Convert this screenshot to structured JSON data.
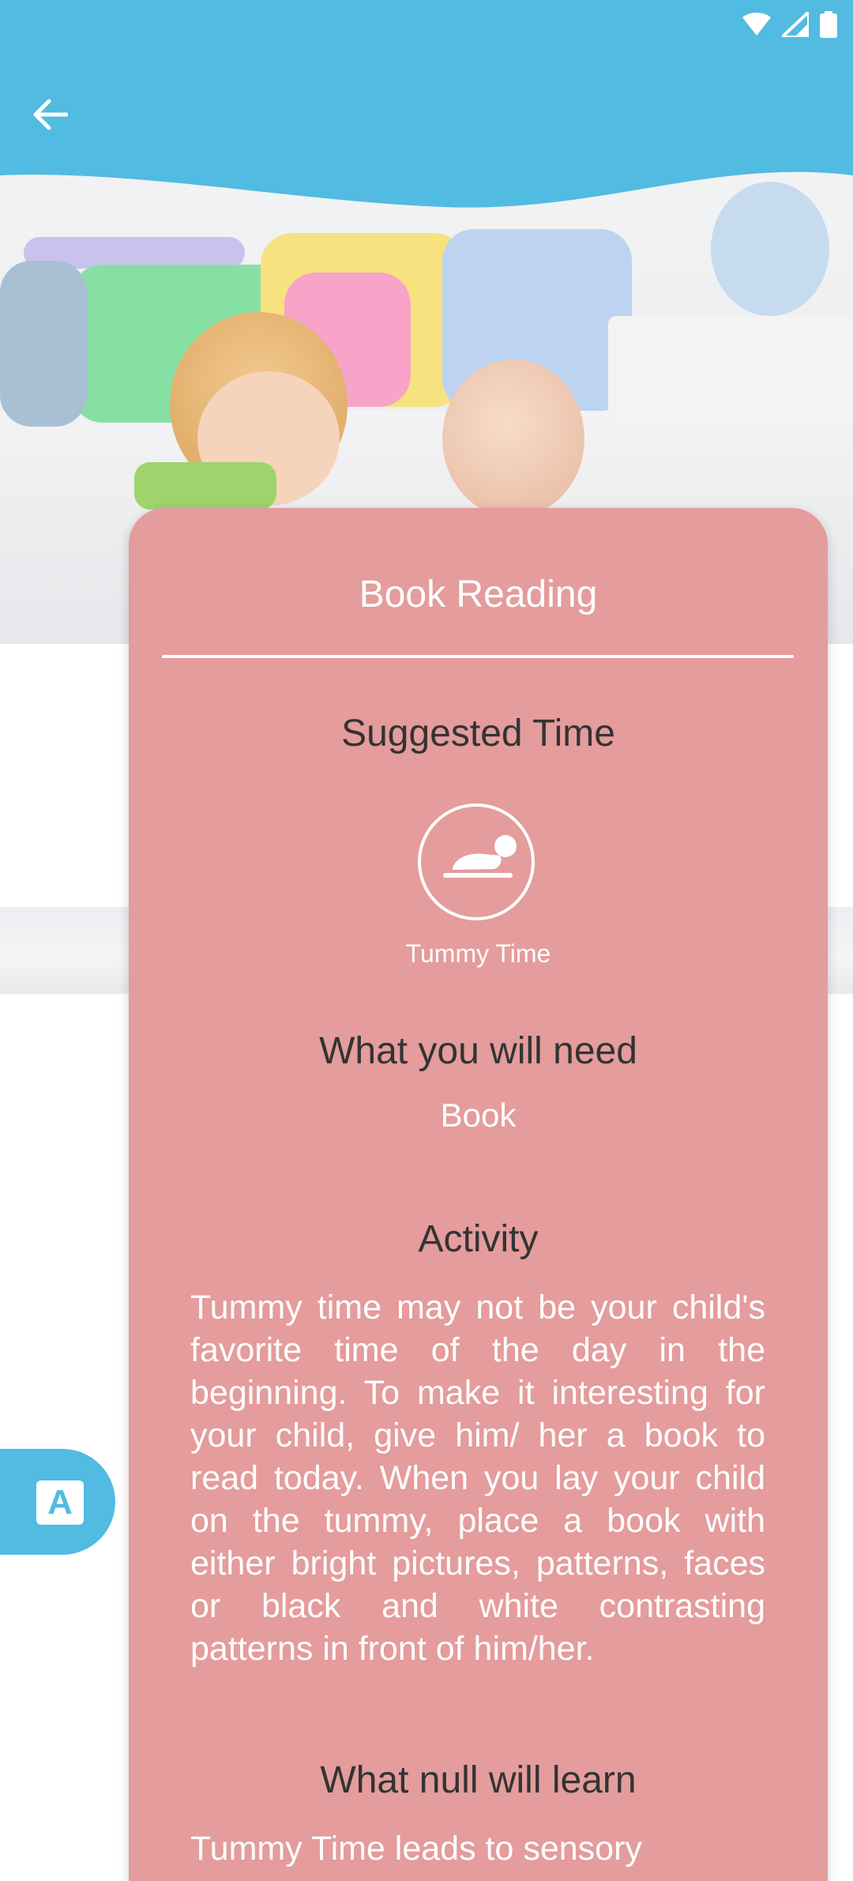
{
  "colors": {
    "header": "#51bbe1",
    "card": "#e49c9c",
    "heading_text": "#333333",
    "light_text": "#ffffff"
  },
  "status_bar": {
    "icons": [
      "wifi-icon",
      "signal-icon",
      "battery-icon"
    ]
  },
  "toolbar": {
    "back_icon": "arrow-left-icon"
  },
  "hero": {
    "image": "toddler-and-baby-on-bed-photo"
  },
  "card": {
    "title": "Book Reading",
    "suggested_time_heading": "Suggested Time",
    "suggested_time_icon": "tummy-time-icon",
    "suggested_time_label": "Tummy Time",
    "need_heading": "What you will need",
    "need_value": "Book",
    "activity_heading": "Activity",
    "activity_text": "Tummy time may not be your child's favorite time of the day in the beginning. To make it interesting for your child, give him/ her a book to read today. When you lay your child on the tummy, place a book with either bright pictures, patterns, faces or black and white contrasting patterns in front of him/her.",
    "learn_heading": "What null will learn",
    "learn_text": "Tummy Time leads to sensory"
  },
  "translate_button": {
    "icon": "translate-icon",
    "glyph": "A"
  }
}
